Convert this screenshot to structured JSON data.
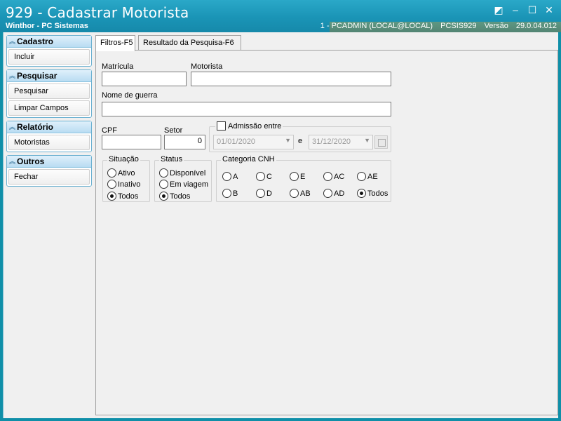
{
  "window": {
    "title": "929 - Cadastrar Motorista",
    "subtitle": "Winthor - PC Sistemas",
    "status": [
      "1 - PCADMIN (LOCAL@LOCAL)",
      "PCSIS929",
      "Versão",
      "29.0.04.012"
    ],
    "controls": [
      "◩",
      "–",
      "☐",
      "✕"
    ]
  },
  "sidebar": {
    "groups": [
      {
        "title": "Cadastro",
        "items": [
          "Incluir"
        ]
      },
      {
        "title": "Pesquisar",
        "items": [
          "Pesquisar",
          "Limpar Campos"
        ]
      },
      {
        "title": "Relatório",
        "items": [
          "Motoristas"
        ]
      },
      {
        "title": "Outros",
        "items": [
          "Fechar"
        ]
      }
    ]
  },
  "tabs": [
    "Filtros-F5",
    "Resultado da Pesquisa-F6"
  ],
  "form": {
    "matricula_label": "Matrícula",
    "matricula_value": "",
    "motorista_label": "Motorista",
    "motorista_value": "",
    "nome_guerra_label": "Nome de guerra",
    "nome_guerra_value": "",
    "cpf_label": "CPF",
    "cpf_value": "",
    "setor_label": "Setor",
    "setor_value": "0",
    "admissao_label": "Admissão entre",
    "admissao_checked": false,
    "date_from": "01/01/2020",
    "date_sep": "e",
    "date_to": "31/12/2020"
  },
  "situacao": {
    "title": "Situação",
    "options": [
      "Ativo",
      "Inativo",
      "Todos"
    ],
    "selected": "Todos"
  },
  "status_group": {
    "title": "Status",
    "options": [
      "Disponível",
      "Em viagem",
      "Todos"
    ],
    "selected": "Todos"
  },
  "cnh": {
    "title": "Categoria CNH",
    "options": [
      "A",
      "C",
      "E",
      "AC",
      "AE",
      "B",
      "D",
      "AB",
      "AD",
      "Todos"
    ],
    "selected": "Todos"
  },
  "colors": {
    "titlebar": "#1a94b6",
    "accent": "#0f8fa8"
  }
}
